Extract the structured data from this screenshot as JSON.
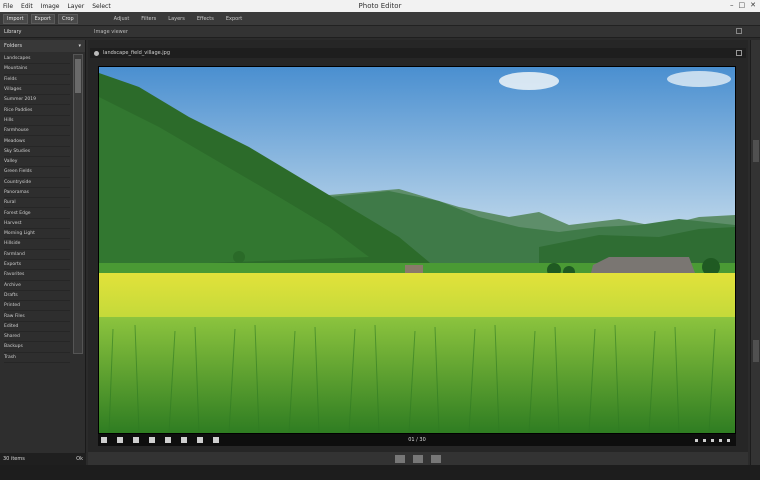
{
  "app": {
    "window_title": "Photo Editor",
    "menus": [
      "File",
      "Edit",
      "Image",
      "Layer",
      "Select"
    ],
    "window_controls": [
      "–",
      "□",
      "✕"
    ]
  },
  "toolbar": {
    "buttons": [
      "Import",
      "Export",
      "Crop"
    ],
    "tabs": [
      "Adjust",
      "Filters",
      "Layers",
      "Effects",
      "Export"
    ]
  },
  "strip": {
    "left_label": "Library",
    "mid_label": "Image viewer"
  },
  "sidebar": {
    "header": "Folders",
    "items": [
      "Landscapes",
      "Mountains",
      "Fields",
      "Villages",
      "Summer 2019",
      "Rice Paddies",
      "Hills",
      "Farmhouse",
      "Meadows",
      "Sky Studies",
      "Valley",
      "Green Fields",
      "Countryside",
      "Panoramas",
      "Rural",
      "Forest Edge",
      "Harvest",
      "Morning Light",
      "Hillside",
      "Farmland",
      "Exports",
      "Favorites",
      "Archive",
      "Drafts",
      "Printed",
      "Raw Files",
      "Edited",
      "Shared",
      "Backups",
      "Trash"
    ],
    "footer_left": "30 items",
    "footer_right": "Ok"
  },
  "viewer": {
    "header_text": "landscape_field_village.jpg",
    "image_alt": "Green rice field with mountains and farmhouse",
    "playbar_label": "01 / 30"
  },
  "colors": {
    "sky_top": "#4a90d0",
    "sky_bottom": "#cfe2f0",
    "field_yellow": "#e8e83a",
    "grass_green": "#4fa83a",
    "hill_green": "#2f6e2f"
  }
}
